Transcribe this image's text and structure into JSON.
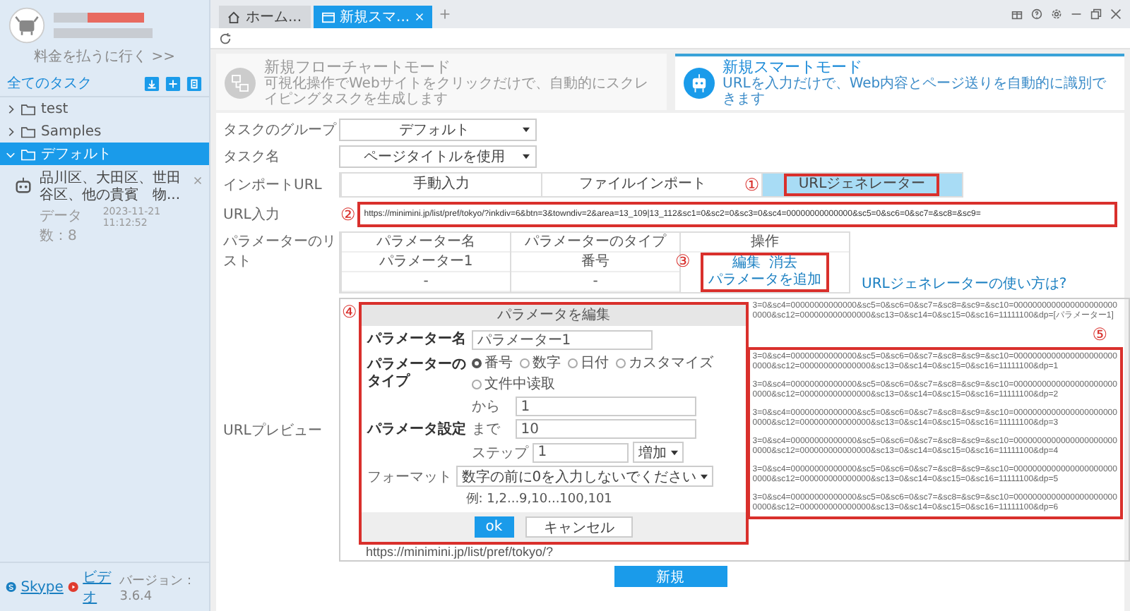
{
  "tabs": [
    {
      "label": "ホーム...",
      "kind": "home",
      "selected": false
    },
    {
      "label": "新規スマ...",
      "kind": "page",
      "selected": true
    }
  ],
  "sidebar": {
    "billing_link": "料金を払うに行く >>",
    "all_tasks": "全てのタスク",
    "folders": [
      {
        "name": "test",
        "expanded": false,
        "selected": false
      },
      {
        "name": "Samples",
        "expanded": false,
        "selected": false
      },
      {
        "name": "デフォルト",
        "expanded": true,
        "selected": true,
        "tasks": [
          {
            "title": "品川区、大田区、世田谷区、他の貴賓　物...",
            "count": "データ数：8",
            "date": "2023-11-21 11:12:52"
          }
        ]
      }
    ],
    "skype": "Skype",
    "video": "ビデオ",
    "version": "バージョン：3.6.4"
  },
  "modes": [
    {
      "kind": "flow",
      "title": "新規フローチャートモード",
      "subtitle": "可視化操作でWebサイトをクリックだけで、自動的にスクレイピングタスクを生成します",
      "selected": false
    },
    {
      "kind": "smart",
      "title": "新規スマートモード",
      "subtitle": "URLを入力だけで、Web内容とページ送りを自動的に識別できます",
      "selected": true
    }
  ],
  "form": {
    "group": {
      "label": "タスクのグループ",
      "value": "デフォルト"
    },
    "task_name": {
      "label": "タスク名",
      "value": "ページタイトルを使用"
    },
    "import_url": {
      "label": "インポートURL",
      "annotation": "①",
      "options": [
        {
          "label": "手動入力",
          "selected": false,
          "highlighted": false
        },
        {
          "label": "ファイルインポート",
          "selected": false,
          "highlighted": false
        },
        {
          "label": "URLジェネレーター",
          "selected": true,
          "highlighted": true
        }
      ]
    },
    "url_input": {
      "label": "URL入力",
      "annotation": "②",
      "highlighted": true,
      "value": "https://minimini.jp/list/pref/tokyo/?inkdiv=6&btn=3&towndiv=2&area=13_109|13_112&sc1=0&sc2=0&sc3=0&sc4=00000000000000&sc5=0&sc6=0&sc7=&sc8=&sc9="
    },
    "param_list": {
      "label": "パラメーターのリスト",
      "annotation": "③",
      "highlighted": true,
      "columns": [
        "パラメーター名",
        "パラメーターのタイプ",
        "操作"
      ],
      "rows": [
        {
          "name": "パラメーター1",
          "type": "番号",
          "actions": [
            "編集",
            "消去"
          ]
        },
        {
          "name": "-",
          "type": "-",
          "actions": [
            "パラメータを追加"
          ]
        }
      ],
      "help_link": "URLジェネレーターの使い方は?"
    },
    "preview": {
      "label": "URLプレビュー",
      "annotation": "⑤",
      "highlighted": true,
      "urls": [
        {
          "lines": [
            "3=0&sc4=00000000000000&sc5=0&sc6=0&sc7=&sc8=&sc9=&sc10=0000000000000000000000",
            "0000&sc12=000000000000000&sc13=0&sc14=0&sc15=0&sc16=11111100&dp=[パラメーター1]"
          ]
        },
        {
          "lines": [
            "3=0&sc4=00000000000000&sc5=0&sc6=0&sc7=&sc8=&sc9=&sc10=0000000000000000000000",
            "0000&sc12=000000000000000&sc13=0&sc14=0&sc15=0&sc16=11111100&dp=1"
          ]
        },
        {
          "lines": [
            "3=0&sc4=00000000000000&sc5=0&sc6=0&sc7=&sc8=&sc9=&sc10=0000000000000000000000",
            "0000&sc12=000000000000000&sc13=0&sc14=0&sc15=0&sc16=11111100&dp=2"
          ]
        },
        {
          "lines": [
            "3=0&sc4=00000000000000&sc5=0&sc6=0&sc7=&sc8=&sc9=&sc10=0000000000000000000000",
            "0000&sc12=000000000000000&sc13=0&sc14=0&sc15=0&sc16=11111100&dp=3"
          ]
        },
        {
          "lines": [
            "3=0&sc4=00000000000000&sc5=0&sc6=0&sc7=&sc8=&sc9=&sc10=0000000000000000000000",
            "0000&sc12=000000000000000&sc13=0&sc14=0&sc15=0&sc16=11111100&dp=4"
          ]
        },
        {
          "lines": [
            "3=0&sc4=00000000000000&sc5=0&sc6=0&sc7=&sc8=&sc9=&sc10=0000000000000000000000",
            "0000&sc12=000000000000000&sc13=0&sc14=0&sc15=0&sc16=11111100&dp=5"
          ]
        },
        {
          "lines": [
            "3=0&sc4=00000000000000&sc5=0&sc6=0&sc7=&sc8=&sc9=&sc10=0000000000000000000000",
            "0000&sc12=000000000000000&sc13=0&sc14=0&sc15=0&sc16=11111100&dp=6"
          ]
        }
      ],
      "url_tail": "https://minimini.jp/list/pref/tokyo/?"
    },
    "dialog": {
      "title": "パラメータを編集",
      "highlighted": true,
      "annotation": "④",
      "name_label": "パラメーター名",
      "name_value": "パラメーター1",
      "type_label": "パラメーターのタイプ",
      "types": [
        {
          "label": "番号",
          "selected": true
        },
        {
          "label": "数字",
          "selected": false
        },
        {
          "label": "日付",
          "selected": false
        },
        {
          "label": "カスタマイズ",
          "selected": false
        },
        {
          "label": "文件中读取",
          "selected": false
        }
      ],
      "settings_label": "パラメータ設定",
      "from_label": "から",
      "from_value": "1",
      "to_label": "まで",
      "to_value": "10",
      "step_label": "ステップ",
      "step_value": "1",
      "direction": "増加",
      "format_label": "フォーマット",
      "format": "数字の前に0を入力しないでください",
      "example": "例: 1,2...9,10...100,101",
      "ok": "ok",
      "cancel": "キャンセル"
    },
    "submit": "新規"
  }
}
